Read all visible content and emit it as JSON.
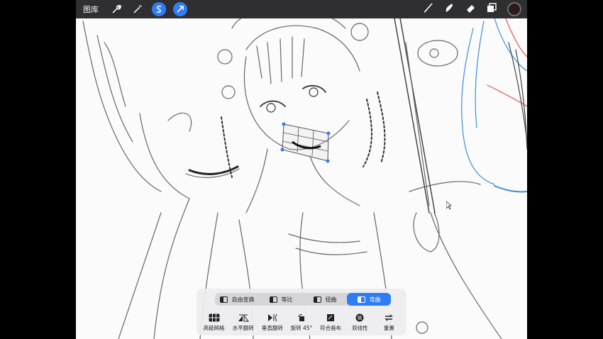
{
  "topbar": {
    "gallery_label": "图库",
    "icons": [
      "wrench-icon",
      "magic-wand-icon",
      "selection-s-icon",
      "transform-arrow-icon",
      "brush-icon",
      "smudge-icon",
      "eraser-icon",
      "layers-icon",
      "color-swatch"
    ],
    "active_color": "#2a1a1c",
    "accent": "#2f7df6"
  },
  "transform": {
    "modes": [
      {
        "label": "自由变换",
        "active": false
      },
      {
        "label": "等比",
        "active": false
      },
      {
        "label": "扭曲",
        "active": false
      },
      {
        "label": "弯曲",
        "active": true
      }
    ],
    "tools": [
      {
        "label": "高级网格",
        "icon": "grid-icon"
      },
      {
        "label": "水平翻转",
        "icon": "flip-horizontal-icon"
      },
      {
        "label": "垂直翻转",
        "icon": "flip-vertical-icon"
      },
      {
        "label": "旋转 45°",
        "icon": "rotate-icon"
      },
      {
        "label": "符合画布",
        "icon": "fit-canvas-icon"
      },
      {
        "label": "双线性",
        "icon": "interpolation-icon"
      },
      {
        "label": "重置",
        "icon": "reset-icon"
      }
    ]
  }
}
